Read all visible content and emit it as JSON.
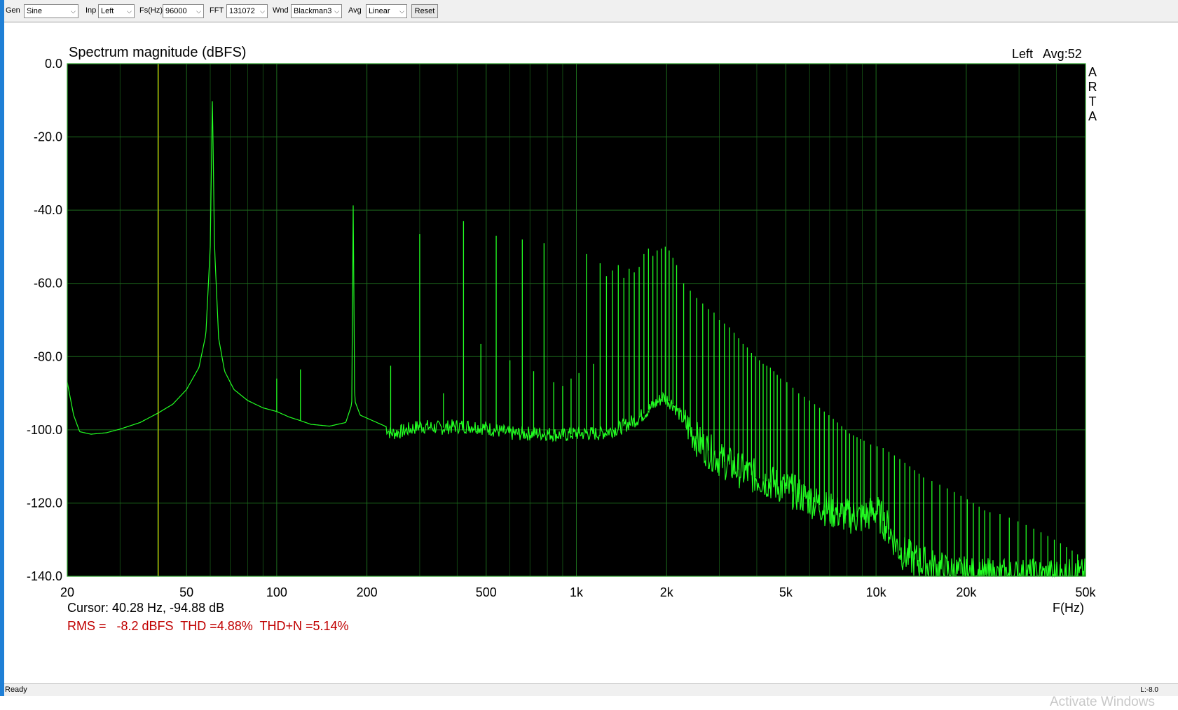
{
  "toolbar": {
    "gen_label": "Gen",
    "gen_value": "Sine",
    "inp_label": "Inp",
    "inp_value": "Left",
    "fs_label": "Fs(Hz)",
    "fs_value": "96000",
    "fft_label": "FFT",
    "fft_value": "131072",
    "wnd_label": "Wnd",
    "wnd_value": "Blackman3",
    "avg_label": "Avg",
    "avg_value": "Linear",
    "reset_label": "Reset"
  },
  "chart_data": {
    "type": "line",
    "title": "Spectrum magnitude (dBFS)",
    "channel_label": "Left",
    "avg_label": "Avg:52",
    "side_logo": [
      "A",
      "R",
      "T",
      "A"
    ],
    "xlabel": "F(Hz)",
    "x_scale": "log",
    "xlim": [
      20,
      50000
    ],
    "ylim": [
      -140,
      0
    ],
    "x_ticks": [
      {
        "value": 20,
        "label": "20"
      },
      {
        "value": 50,
        "label": "50"
      },
      {
        "value": 100,
        "label": "100"
      },
      {
        "value": 200,
        "label": "200"
      },
      {
        "value": 500,
        "label": "500"
      },
      {
        "value": 1000,
        "label": "1k"
      },
      {
        "value": 2000,
        "label": "2k"
      },
      {
        "value": 5000,
        "label": "5k"
      },
      {
        "value": 10000,
        "label": "10k"
      },
      {
        "value": 20000,
        "label": "20k"
      },
      {
        "value": 50000,
        "label": "50k"
      }
    ],
    "y_ticks": [
      {
        "value": 0,
        "label": "0.0"
      },
      {
        "value": -20,
        "label": "-20.0"
      },
      {
        "value": -40,
        "label": "-40.0"
      },
      {
        "value": -60,
        "label": "-60.0"
      },
      {
        "value": -80,
        "label": "-80.0"
      },
      {
        "value": -100,
        "label": "-100.0"
      },
      {
        "value": -120,
        "label": "-120.0"
      },
      {
        "value": -140,
        "label": "-140.0"
      }
    ],
    "grid": true,
    "colors": {
      "plot_bg": "#000000",
      "grid": "#1c6b1c",
      "trace": "#22ff22",
      "cursor": "#c8c800",
      "stats": "#c00000"
    },
    "cursor": {
      "freq_hz": 40.28,
      "level_db": -94.88,
      "text": "Cursor: 40.28 Hz, -94.88 dB"
    },
    "stats_text": "RMS =   -8.2 dBFS  THD =4.88%  THD+N =5.14%",
    "floor": [
      [
        20,
        -87
      ],
      [
        21,
        -96
      ],
      [
        22,
        -100.5
      ],
      [
        24,
        -101.2
      ],
      [
        27,
        -100.8
      ],
      [
        30,
        -99.8
      ],
      [
        35,
        -98
      ],
      [
        40,
        -95.5
      ],
      [
        45,
        -93
      ],
      [
        50,
        -89
      ],
      [
        55,
        -83
      ],
      [
        58,
        -74
      ],
      [
        60,
        -50
      ],
      [
        61,
        -9
      ],
      [
        62,
        -50
      ],
      [
        64,
        -75
      ],
      [
        67,
        -84
      ],
      [
        72,
        -89
      ],
      [
        80,
        -92
      ],
      [
        90,
        -94
      ],
      [
        100,
        -95
      ],
      [
        110,
        -96.5
      ],
      [
        120,
        -97.5
      ],
      [
        130,
        -98.5
      ],
      [
        150,
        -99
      ],
      [
        170,
        -98
      ],
      [
        178,
        -93
      ],
      [
        180,
        -37.5
      ],
      [
        182,
        -92
      ],
      [
        190,
        -96
      ],
      [
        230,
        -99
      ],
      [
        240,
        -101
      ],
      [
        260,
        -100.5
      ],
      [
        300,
        -99
      ],
      [
        350,
        -99.5
      ],
      [
        400,
        -99
      ],
      [
        450,
        -99
      ],
      [
        500,
        -99.5
      ],
      [
        600,
        -101
      ],
      [
        700,
        -101
      ],
      [
        800,
        -101
      ],
      [
        900,
        -101.5
      ],
      [
        1000,
        -101
      ],
      [
        1200,
        -101
      ],
      [
        1400,
        -99.5
      ],
      [
        1600,
        -97
      ],
      [
        1800,
        -93.5
      ],
      [
        1950,
        -91
      ],
      [
        2100,
        -93
      ],
      [
        2300,
        -98
      ],
      [
        2600,
        -104
      ],
      [
        3000,
        -108
      ],
      [
        3500,
        -111
      ],
      [
        4000,
        -113
      ],
      [
        5000,
        -116
      ],
      [
        6000,
        -119
      ],
      [
        7000,
        -122
      ],
      [
        8000,
        -123.5
      ],
      [
        9000,
        -124
      ],
      [
        10000,
        -122
      ],
      [
        11000,
        -127
      ],
      [
        12000,
        -133
      ],
      [
        13000,
        -135
      ],
      [
        15000,
        -137
      ],
      [
        18000,
        -139
      ],
      [
        22000,
        -140
      ]
    ],
    "peaks": [
      [
        100,
        -86
      ],
      [
        120,
        -83.5
      ],
      [
        240,
        -82.5
      ],
      [
        300,
        -46.5
      ],
      [
        360,
        -90
      ],
      [
        420,
        -43
      ],
      [
        480,
        -76.5
      ],
      [
        540,
        -47
      ],
      [
        600,
        -81
      ],
      [
        660,
        -48
      ],
      [
        720,
        -84
      ],
      [
        780,
        -49
      ],
      [
        840,
        -87
      ],
      [
        900,
        -88
      ],
      [
        960,
        -86
      ],
      [
        1020,
        -84.5
      ],
      [
        1080,
        -52
      ],
      [
        1140,
        -82
      ],
      [
        1200,
        -54.5
      ],
      [
        1260,
        -58
      ],
      [
        1320,
        -56.5
      ],
      [
        1380,
        -55
      ],
      [
        1440,
        -58.5
      ],
      [
        1500,
        -56
      ],
      [
        1560,
        -57
      ],
      [
        1620,
        -55.5
      ],
      [
        1680,
        -52
      ],
      [
        1740,
        -50.5
      ],
      [
        1800,
        -52.5
      ],
      [
        1860,
        -51
      ],
      [
        1920,
        -50.5
      ],
      [
        1980,
        -50
      ],
      [
        2040,
        -51
      ],
      [
        2100,
        -53
      ],
      [
        2160,
        -55
      ],
      [
        2280,
        -60
      ],
      [
        2400,
        -62
      ],
      [
        2520,
        -64
      ],
      [
        2640,
        -65.5
      ],
      [
        2760,
        -67
      ],
      [
        2880,
        -68
      ],
      [
        3000,
        -70
      ],
      [
        3120,
        -71
      ],
      [
        3240,
        -72
      ],
      [
        3360,
        -73.5
      ],
      [
        3480,
        -75
      ],
      [
        3600,
        -76.5
      ],
      [
        3720,
        -77.5
      ],
      [
        3840,
        -79
      ],
      [
        3960,
        -80
      ],
      [
        4080,
        -81
      ],
      [
        4200,
        -82
      ],
      [
        4320,
        -82.5
      ],
      [
        4440,
        -83
      ],
      [
        4560,
        -84
      ],
      [
        4680,
        -85
      ],
      [
        4800,
        -86
      ],
      [
        5040,
        -87
      ],
      [
        5280,
        -88.5
      ],
      [
        5520,
        -90
      ],
      [
        5760,
        -91
      ],
      [
        6000,
        -92
      ],
      [
        6240,
        -93
      ],
      [
        6480,
        -94
      ],
      [
        6720,
        -95
      ],
      [
        6960,
        -96
      ],
      [
        7200,
        -97
      ],
      [
        7440,
        -98
      ],
      [
        7680,
        -99
      ],
      [
        7920,
        -100
      ],
      [
        8160,
        -101
      ],
      [
        8400,
        -101.5
      ],
      [
        8640,
        -102
      ],
      [
        8880,
        -102.5
      ],
      [
        9120,
        -103
      ],
      [
        9600,
        -104
      ],
      [
        10080,
        -104.5
      ],
      [
        10560,
        -105
      ],
      [
        11040,
        -106
      ],
      [
        11520,
        -107
      ],
      [
        12000,
        -108
      ],
      [
        12480,
        -109
      ],
      [
        12960,
        -110
      ],
      [
        13440,
        -111
      ],
      [
        13920,
        -112
      ],
      [
        14400,
        -113
      ],
      [
        15360,
        -114
      ],
      [
        16320,
        -115
      ],
      [
        17280,
        -116
      ],
      [
        18240,
        -117
      ],
      [
        19200,
        -118
      ],
      [
        20160,
        -119
      ],
      [
        21120,
        -120
      ],
      [
        22080,
        -121
      ],
      [
        23040,
        -122
      ],
      [
        24000,
        -122.5
      ],
      [
        25920,
        -123
      ],
      [
        27840,
        -124
      ],
      [
        29760,
        -125
      ],
      [
        31680,
        -126
      ],
      [
        33600,
        -127
      ],
      [
        35520,
        -128
      ],
      [
        37440,
        -129
      ],
      [
        39360,
        -130
      ],
      [
        41280,
        -131
      ],
      [
        43200,
        -132
      ],
      [
        45120,
        -133
      ],
      [
        47040,
        -134
      ]
    ]
  },
  "status": {
    "ready": "Ready",
    "level": "L:-8.0"
  },
  "watermark": "Activate Windows"
}
